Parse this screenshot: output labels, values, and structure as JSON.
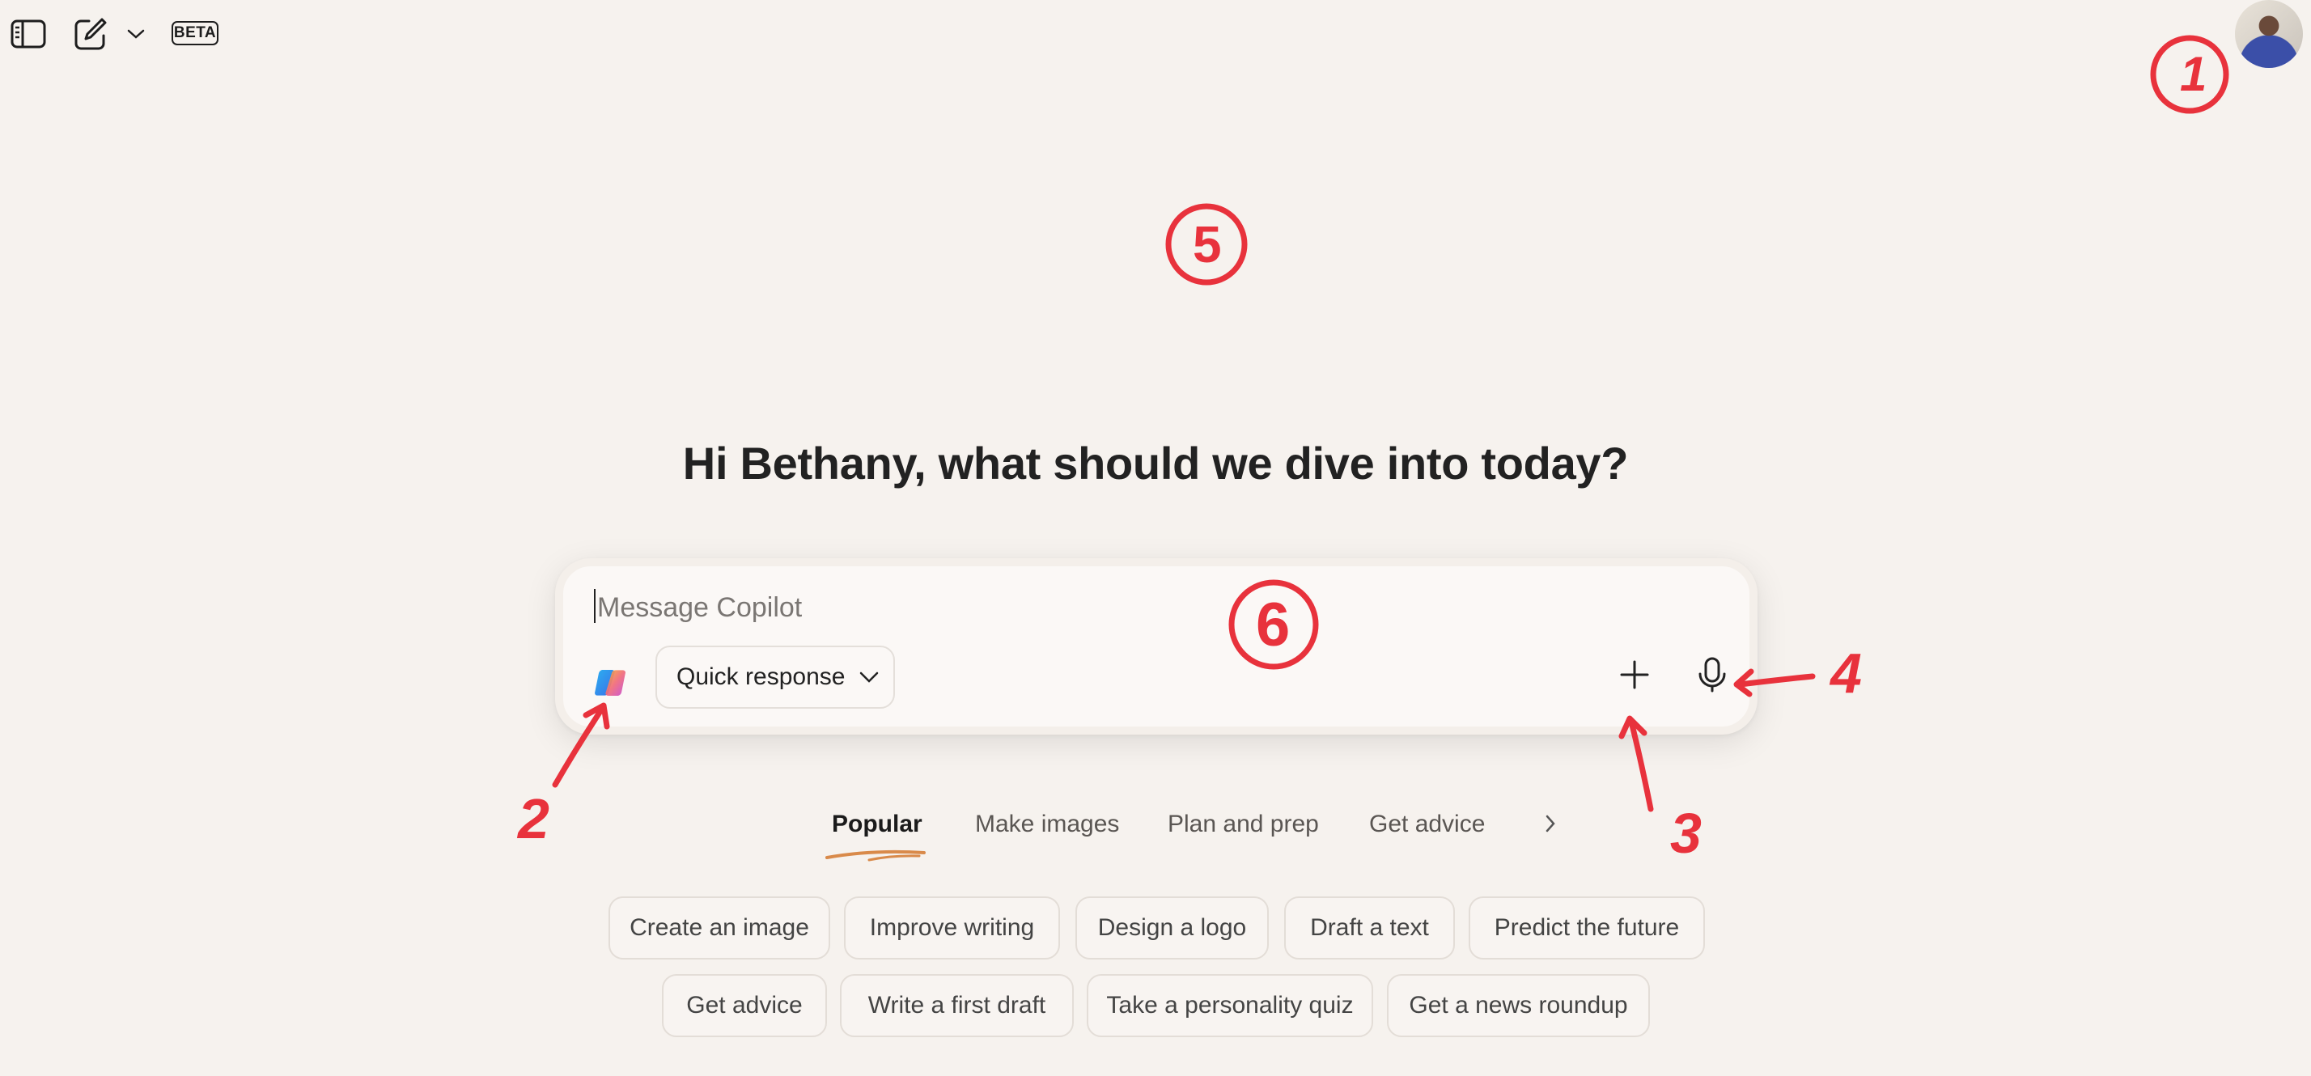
{
  "toolbar": {
    "beta_label": "BETA",
    "icons": [
      "sidebar-toggle-icon",
      "new-chat-icon",
      "chevron-down-icon"
    ]
  },
  "greeting": "Hi Bethany, what should we dive into today?",
  "composer": {
    "placeholder": "Message Copilot",
    "mode": "Quick response",
    "icons": [
      "copilot-logo-icon",
      "plus-icon",
      "microphone-icon"
    ]
  },
  "tabs": [
    {
      "label": "Popular",
      "active": true
    },
    {
      "label": "Make images"
    },
    {
      "label": "Plan and prep"
    },
    {
      "label": "Get advice"
    }
  ],
  "chips_row1": [
    "Create an image",
    "Improve writing",
    "Design a logo",
    "Draft a text",
    "Predict the future"
  ],
  "chips_row2": [
    "Get advice",
    "Write a first draft",
    "Take a personality quiz",
    "Get a news roundup"
  ],
  "annotations": {
    "n1": "1",
    "n2": "2",
    "n3": "3",
    "n4": "4",
    "n5": "5",
    "n6": "6"
  },
  "colors": {
    "background": "#f6f2ee",
    "annotation_red": "#e8323c",
    "tab_underline": "#d98a4a"
  }
}
